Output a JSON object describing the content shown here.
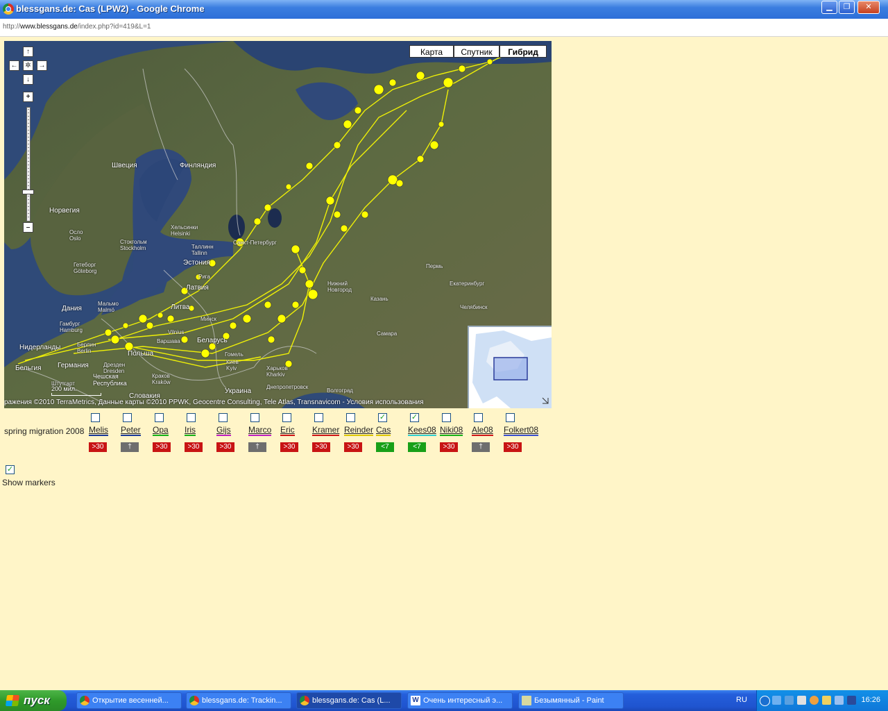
{
  "window": {
    "title": "blessgans.de: Cas (LPW2) - Google Chrome",
    "minimize": "▁",
    "restore": "❐",
    "close": "✕"
  },
  "address": {
    "prefix": "http://",
    "domain": "www.blessgans.de",
    "path": "/index.php?id=419&L=1"
  },
  "map": {
    "type_buttons": [
      "Карта",
      "Спутник",
      "Гибрид"
    ],
    "active_type": "Гибрид",
    "nav": {
      "up": "↑",
      "down": "↓",
      "left": "←",
      "right": "→",
      "center": "✲",
      "zoom_in": "+",
      "zoom_out": "–"
    },
    "labels": {
      "sweden": "Швеция",
      "finland": "Финляндия",
      "norway": "Норвегия",
      "helsinki": "Хельсинки Helsinki",
      "stockholm": "Стокгольм Stockholm",
      "oslo": "Осло Oslo",
      "tallinn": "Таллинн Tallinn",
      "estonia": "Эстония",
      "stpetersburg": "Санкт-Петербург",
      "goteborg": "Гетеборг Göteborg",
      "riga": "Рига",
      "latvia": "Латвия",
      "lithuania": "Литва",
      "vilnius": "Vilnius",
      "minsk": "Минск",
      "belarus": "Беларусь",
      "denmark": "Дания",
      "malmo": "Мальмо Malmö",
      "hamburg": "Гамбург Hamburg",
      "berlin": "Берлин Berlin",
      "germany": "Германия",
      "netherlands": "Нидерланды",
      "belgium": "Бельгия",
      "poland": "Польша",
      "warsaw": "Варшава",
      "dresden": "Дрезден Dresden",
      "czech": "Чешская Республика",
      "stuttgart": "Штутгарт",
      "krakow": "Краков Kraków",
      "slovakia": "Словакия",
      "kyiv": "Киев Kyiv",
      "ukraine": "Украина",
      "kharkiv": "Харьков Kharkiv",
      "gomel": "Гомель",
      "dnepropetrovsk": "Днепропетровск",
      "volgograd": "Волгоград",
      "nizhny": "Нижний Новгород",
      "kazan": "Казань",
      "samara": "Самара",
      "perm": "Пермь",
      "ekaterinburg": "Екатеринбург",
      "chelyabinsk": "Челябинск"
    },
    "scale": "200 мил.",
    "attribution": "ражения ©2010 TerraMetrics, Данные карты ©2010 PPWK, Geocentre Consulting, Tele Atlas, Transnavicom - Условия использования",
    "track_color": "#ffff00"
  },
  "season_label": "spring migration 2008",
  "birds": [
    {
      "name": "Melis",
      "color": "#1a3a9a",
      "checked": false,
      "status": ">30",
      "status_color": "#c81414"
    },
    {
      "name": "Peter",
      "color": "#1a3a9a",
      "checked": false,
      "status": "†",
      "status_color": "#6e6e6e"
    },
    {
      "name": "Opa",
      "color": "#18b418",
      "checked": false,
      "status": ">30",
      "status_color": "#c81414"
    },
    {
      "name": "Iris",
      "color": "#18b418",
      "checked": false,
      "status": ">30",
      "status_color": "#c81414"
    },
    {
      "name": "Gijs",
      "color": "#c020c0",
      "checked": false,
      "status": ">30",
      "status_color": "#c81414"
    },
    {
      "name": "Marco",
      "color": "#c020c0",
      "checked": false,
      "status": "†",
      "status_color": "#6e6e6e"
    },
    {
      "name": "Eric",
      "color": "#d01818",
      "checked": false,
      "status": ">30",
      "status_color": "#c81414"
    },
    {
      "name": "Kramer",
      "color": "#d01818",
      "checked": false,
      "status": ">30",
      "status_color": "#c81414"
    },
    {
      "name": "Reinder",
      "color": "#e0c800",
      "checked": false,
      "status": ">30",
      "status_color": "#c81414"
    },
    {
      "name": "Cas",
      "color": "#e0c800",
      "checked": true,
      "status": "<7",
      "status_color": "#18a018"
    },
    {
      "name": "Kees08",
      "color": "#30d0d0",
      "checked": true,
      "status": "<7",
      "status_color": "#18a018"
    },
    {
      "name": "Niki08",
      "color": "#18b418",
      "checked": false,
      "status": ">30",
      "status_color": "#c81414"
    },
    {
      "name": "Ale08",
      "color": "#d01818",
      "checked": false,
      "status": "†",
      "status_color": "#6e6e6e"
    },
    {
      "name": "Folkert08",
      "color": "#3a50d0",
      "checked": false,
      "status": ">30",
      "status_color": "#c81414"
    }
  ],
  "show_markers": {
    "label": "Show markers",
    "checked": true
  },
  "taskbar": {
    "start": "пуск",
    "tasks": [
      "Открытие весенней...",
      "blessgans.de: Trackin...",
      "blessgans.de: Cas (L...",
      "Очень интересный э...",
      "Безымянный - Paint"
    ],
    "active_task": 2,
    "language": "RU",
    "clock": "16:26"
  }
}
